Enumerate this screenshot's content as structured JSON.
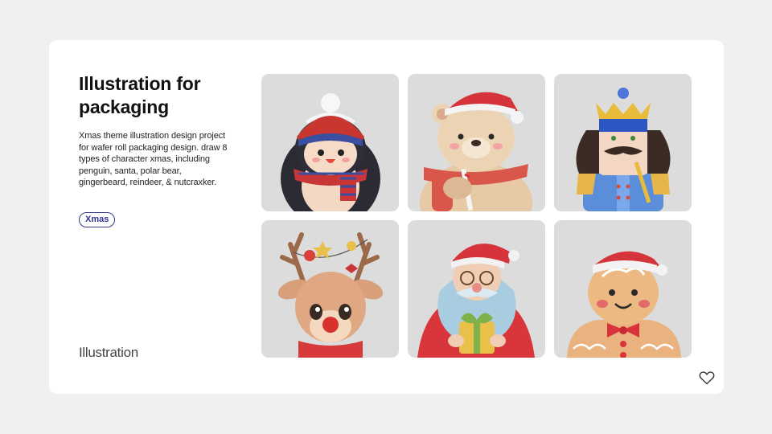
{
  "project": {
    "title": "Illustration for packaging",
    "description": "Xmas theme illustration design project for wafer roll packaging design. draw 8 types of character xmas, including penguin, santa, polar bear, gingerbeard, reindeer, & nutcraxker.",
    "tag": "Xmas",
    "category": "Illustration"
  },
  "gallery": {
    "items": [
      {
        "subject": "penguin",
        "icon": "penguin-illustration"
      },
      {
        "subject": "polar bear",
        "icon": "bear-illustration"
      },
      {
        "subject": "nutcracker",
        "icon": "nutcracker-illustration"
      },
      {
        "subject": "reindeer",
        "icon": "reindeer-illustration"
      },
      {
        "subject": "santa",
        "icon": "santa-illustration"
      },
      {
        "subject": "gingerbread",
        "icon": "gingerbread-illustration"
      }
    ]
  },
  "actions": {
    "like_icon": "heart-outline-icon"
  },
  "colors": {
    "card_background": "#ffffff",
    "page_background": "#f0f0f0",
    "tile_background": "#dcdcdc",
    "tag_border": "#333a8a",
    "tag_text": "#2c3590"
  }
}
